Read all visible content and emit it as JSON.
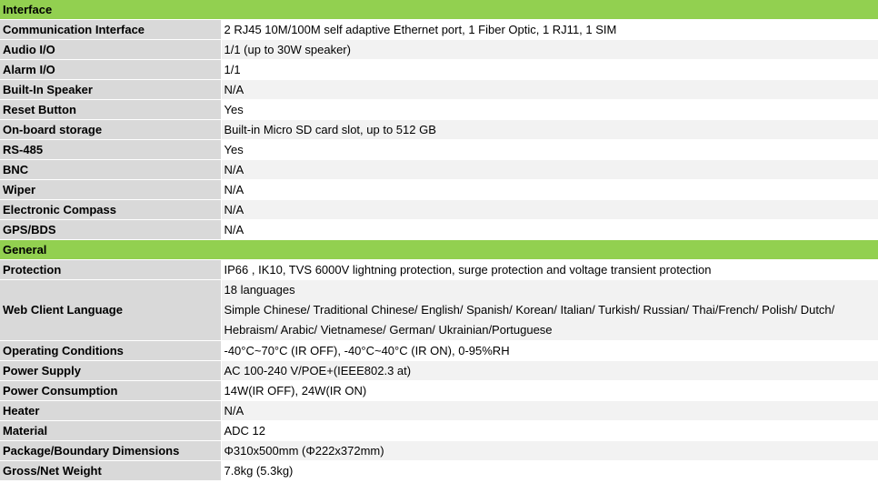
{
  "sections": [
    {
      "title": "Interface",
      "rows": [
        {
          "label": "Communication Interface",
          "value": [
            "2 RJ45 10M/100M self adaptive Ethernet port, 1 Fiber Optic, 1 RJ11, 1 SIM"
          ]
        },
        {
          "label": "Audio I/O",
          "value": [
            "1/1 (up to 30W speaker)"
          ]
        },
        {
          "label": "Alarm I/O",
          "value": [
            "1/1"
          ]
        },
        {
          "label": "Built-In Speaker",
          "value": [
            "N/A"
          ]
        },
        {
          "label": "Reset Button",
          "value": [
            "Yes"
          ]
        },
        {
          "label": "On-board storage",
          "value": [
            "Built-in Micro SD card slot, up to 512 GB"
          ]
        },
        {
          "label": "RS-485",
          "value": [
            "Yes"
          ]
        },
        {
          "label": "BNC",
          "value": [
            "N/A"
          ]
        },
        {
          "label": "Wiper",
          "value": [
            "N/A"
          ]
        },
        {
          "label": "Electronic Compass",
          "value": [
            "N/A"
          ]
        },
        {
          "label": "GPS/BDS",
          "value": [
            "N/A"
          ]
        }
      ]
    },
    {
      "title": "General",
      "rows": [
        {
          "label": "Protection",
          "value": [
            "IP66 , IK10, TVS 6000V lightning protection, surge protection and voltage transient protection"
          ]
        },
        {
          "label": "Web Client Language",
          "value": [
            "18 languages",
            "Simple Chinese/ Traditional Chinese/ English/ Spanish/ Korean/ Italian/ Turkish/ Russian/ Thai/French/ Polish/ Dutch/",
            "Hebraism/ Arabic/ Vietnamese/ German/ Ukrainian/Portuguese"
          ]
        },
        {
          "label": "Operating Conditions",
          "value": [
            "-40°C~70°C (IR OFF),  -40°C~40°C (IR ON), 0-95%RH"
          ]
        },
        {
          "label": "Power Supply",
          "value": [
            "AC 100-240 V/POE+(IEEE802.3 at)"
          ]
        },
        {
          "label": "Power Consumption",
          "value": [
            "14W(IR OFF), 24W(IR ON)"
          ]
        },
        {
          "label": "Heater",
          "value": [
            "N/A"
          ]
        },
        {
          "label": "Material",
          "value": [
            "ADC 12"
          ]
        },
        {
          "label": "Package/Boundary Dimensions",
          "value": [
            "Φ310x500mm (Φ222x372mm)"
          ]
        },
        {
          "label": "Gross/Net Weight",
          "value": [
            "7.8kg (5.3kg)"
          ]
        }
      ]
    }
  ],
  "colors": {
    "section_header": "#92d050",
    "label_cell": "#d9d9d9",
    "value_alt": "#f2f2f2"
  }
}
